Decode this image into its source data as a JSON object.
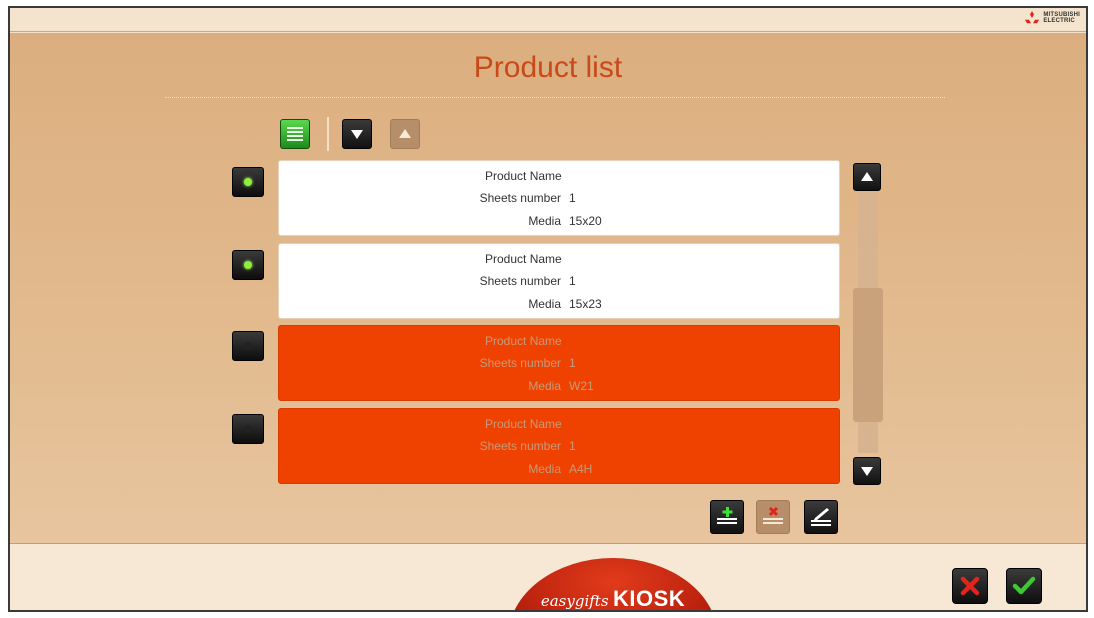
{
  "header": {
    "brand_line1": "MITSUBISHI",
    "brand_line2": "ELECTRIC"
  },
  "page": {
    "title": "Product list"
  },
  "toolbar": {
    "icons": [
      "list-view-icon",
      "arrow-down-icon",
      "arrow-up-icon"
    ]
  },
  "products": [
    {
      "name_label": "Product Name",
      "sheets_label": "Sheets number",
      "sheets_value": "1",
      "media_label": "Media",
      "media_value": "15x20",
      "selected": true,
      "status": "ok"
    },
    {
      "name_label": "Product Name",
      "sheets_label": "Sheets number",
      "sheets_value": "1",
      "media_label": "Media",
      "media_value": "15x23",
      "selected": true,
      "status": "ok"
    },
    {
      "name_label": "Product Name",
      "sheets_label": "Sheets number",
      "sheets_value": "1",
      "media_label": "Media",
      "media_value": "W21",
      "selected": false,
      "status": "error"
    },
    {
      "name_label": "Product Name",
      "sheets_label": "Sheets number",
      "sheets_value": "1",
      "media_label": "Media",
      "media_value": "A4H",
      "selected": false,
      "status": "error"
    }
  ],
  "actions": {
    "icons": [
      "add-product-icon",
      "remove-product-icon",
      "edit-product-icon"
    ]
  },
  "footer": {
    "brand_prefix": "easygifts",
    "brand_suffix": "KIOSK"
  },
  "colors": {
    "accent": "#c84a1a",
    "error_row": "#ef4200",
    "ok_dot": "#8fef3a",
    "confirm": "#3cc832",
    "cancel": "#e0261c"
  }
}
